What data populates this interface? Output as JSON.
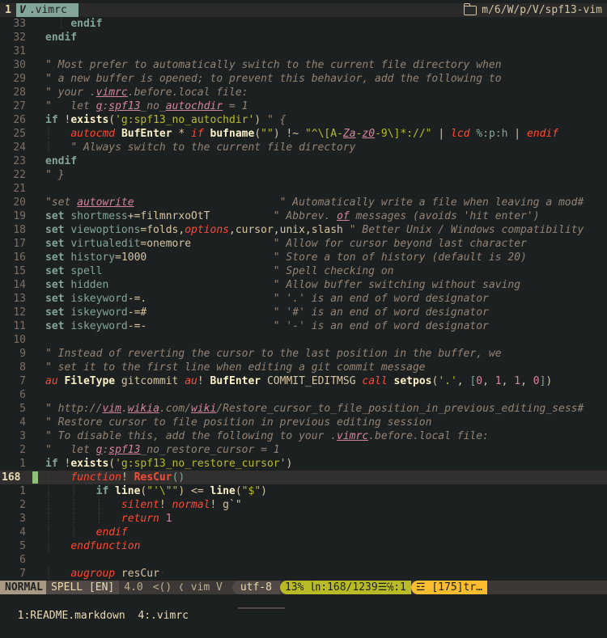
{
  "tabline": {
    "tab_number": "1",
    "vim_icon": "V",
    "tab_label": ".vimrc",
    "folder_icon": "folder-icon",
    "path": "m/6/W/p/V/spf13-vim"
  },
  "statusline": {
    "mode": "NORMAL",
    "spell": "SPELL [EN]",
    "version": "4.0",
    "lsp": "<() ❬ vim V",
    "encoding": "utf-8",
    "position": "13% ㏑:168/1239☰℅:1",
    "errors": "☲ [175]tr…"
  },
  "bufferline": {
    "buffers": "1:README.markdown  4:.vimrc"
  },
  "colors": {
    "background": "#1d2021",
    "comment": "#928374",
    "keyword": "#83a598",
    "string": "#b8bb26",
    "number": "#d3869b",
    "sign": "#8ec07c"
  }
}
